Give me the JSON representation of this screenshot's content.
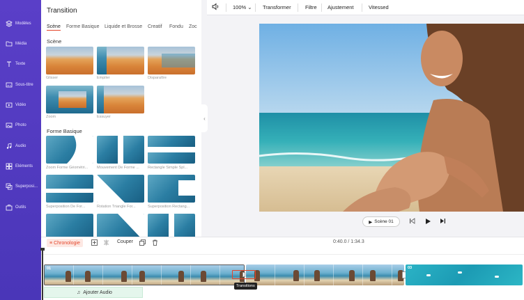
{
  "sidebar": {
    "items": [
      {
        "label": "Modèles",
        "icon": "layers-icon"
      },
      {
        "label": "Média",
        "icon": "folder-icon"
      },
      {
        "label": "Texte",
        "icon": "text-icon"
      },
      {
        "label": "Sous-titre",
        "icon": "subtitle-icon"
      },
      {
        "label": "Vidéo",
        "icon": "video-icon"
      },
      {
        "label": "Photo",
        "icon": "photo-icon"
      },
      {
        "label": "Audio",
        "icon": "music-icon"
      },
      {
        "label": "Eléments",
        "icon": "elements-icon"
      },
      {
        "label": "Superposi...",
        "icon": "overlay-icon"
      },
      {
        "label": "Outils",
        "icon": "tools-icon"
      }
    ]
  },
  "panel": {
    "title": "Transition",
    "tabs": [
      "Scène",
      "Forme Basique",
      "Liquide et Brosse",
      "Creatif",
      "Fondu",
      "Zoc"
    ],
    "sections": [
      {
        "title": "Scène",
        "items": [
          "Glisser",
          "Empiler",
          "Disparaître",
          "Zoom",
          "Essuyer"
        ]
      },
      {
        "title": "Forme Basique",
        "items": [
          "Zoom Forme Géométri...",
          "Mouvement De Forme ...",
          "Rectangle Simple Spl...",
          "Superposition De For...",
          "Rotation Triangle For...",
          "Superposition Rectang..."
        ]
      }
    ]
  },
  "toolbar": {
    "zoom": "100%",
    "transform": "Transformer",
    "filter": "Filtre",
    "adjust": "Ajustement",
    "speed": "Vitessed"
  },
  "player": {
    "scene_label": "Scène 01"
  },
  "timeline": {
    "chrono_label": "Chronologie",
    "cut_label": "Couper",
    "time": "0:40.0 / 1:34.3",
    "clips": [
      {
        "label": "01"
      },
      {
        "label": ""
      },
      {
        "label": "03"
      }
    ],
    "transition_tooltip": "Transitions",
    "add_audio": "Ajouter Audio"
  },
  "colors": {
    "sidebar": "#4a36b8",
    "accent": "#e4452a",
    "audio_track": "#e4f6ec"
  }
}
